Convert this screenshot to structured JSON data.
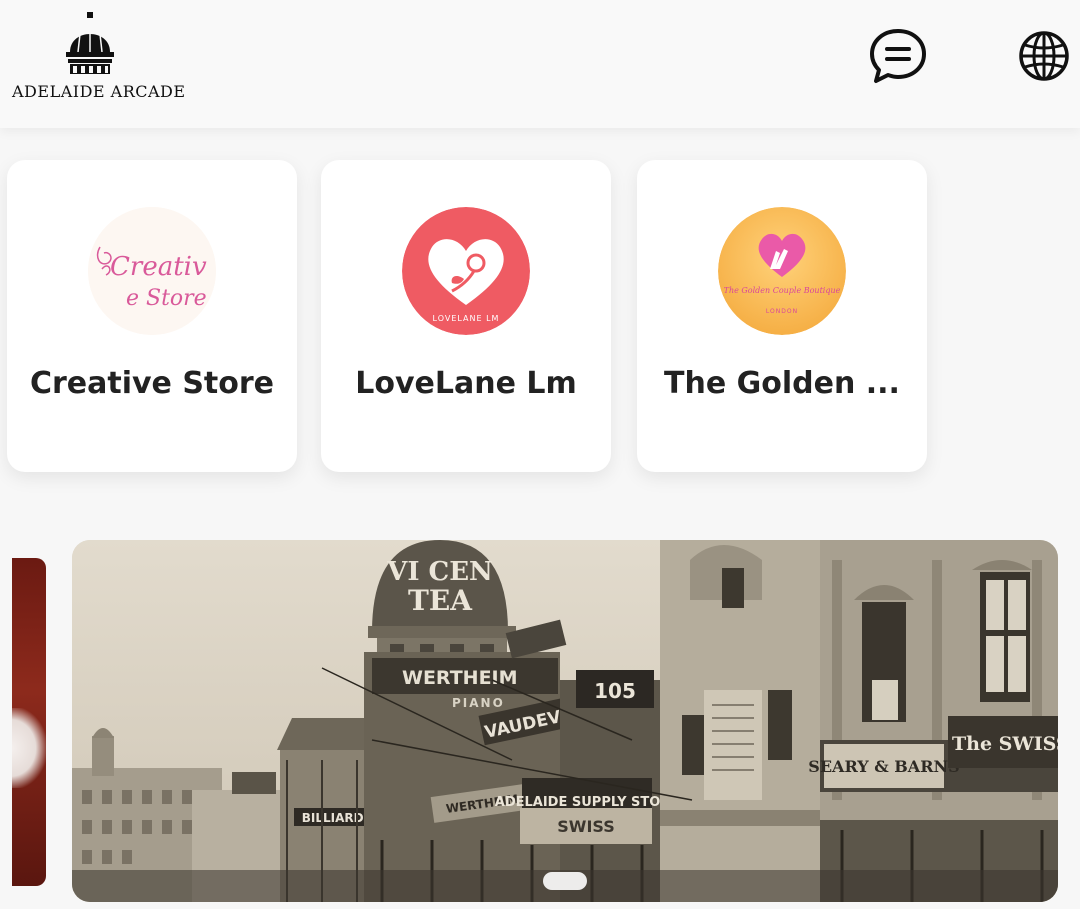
{
  "header": {
    "logo_text": "ADELAIDE ARCADE",
    "logo_icon": "dome-icon",
    "chat_icon": "chat-bubble-icon",
    "language_icon": "globe-icon"
  },
  "stores": [
    {
      "name": "Creative Store",
      "logo_text_1": "Creativ",
      "logo_text_2": "e Store",
      "accent": "#d95a9a"
    },
    {
      "name": "LoveLane Lm",
      "logo_text": "LOVELANE LM",
      "accent": "#ef5b63"
    },
    {
      "name": "The Golden ...",
      "logo_text": "The Golden Couple Boutique",
      "logo_subtext": "LONDON",
      "accent": "#f7b84b"
    }
  ],
  "banner": {
    "sign_tea_1": "VI CEN",
    "sign_tea_2": "TEA",
    "sign_wertheim_1": "WERTHEIM",
    "sign_wertheim_2": "WERTHEIM",
    "sign_piano": "PIANO",
    "sign_105": "105",
    "sign_vaudeville": "VAUDEVILLE",
    "sign_supply": "ADELAIDE SUPPLY STORE",
    "sign_billiards": "BILLIARDS",
    "sign_seary": "SEARY & BARNS",
    "sign_swiss": "The SWISS STO",
    "sign_swiss_2": "SWISS"
  }
}
